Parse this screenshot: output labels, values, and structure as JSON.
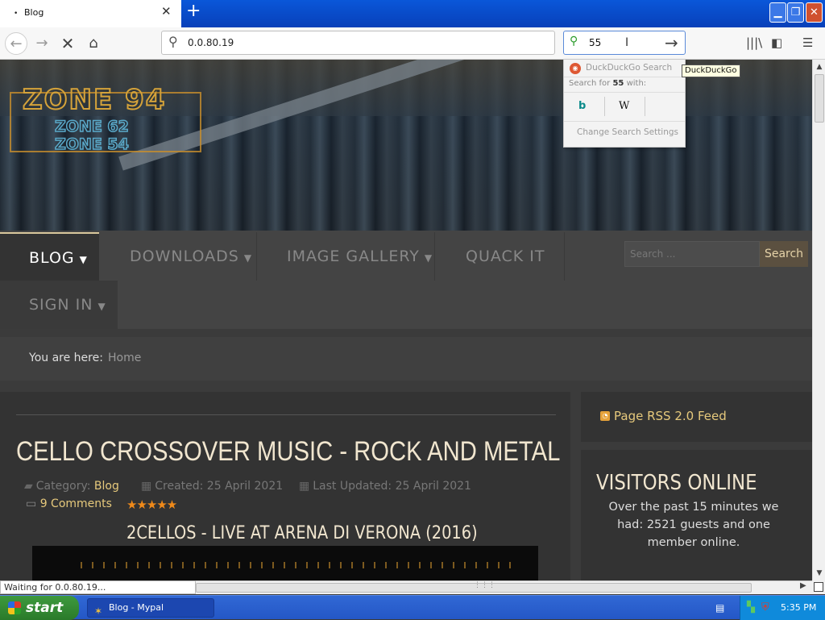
{
  "browser": {
    "tab_title": "Blog",
    "tab_icon": "•",
    "tab_close": "✕",
    "new_tab": "+",
    "url": "0.0.80.19",
    "search_value": "55",
    "window": {
      "min": "▁",
      "max": "❐",
      "close": "✕"
    }
  },
  "search_dropdown": {
    "engine": "DuckDuckGo Search",
    "search_for_prefix": "Search for ",
    "search_for_term": "55",
    "search_for_suffix": " with:",
    "engines": [
      "b",
      "W"
    ],
    "settings": "Change Search Settings",
    "tooltip": "DuckDuckGo"
  },
  "site": {
    "logo": {
      "main": "ZONE 94",
      "sub1": "ZONE 62",
      "sub2": "ZONE 54"
    },
    "menu": {
      "blog": "BLOG",
      "downloads": "DOWNLOADS",
      "gallery": "IMAGE GALLERY",
      "quack": "QUACK IT",
      "signin": "SIGN IN"
    },
    "search_placeholder": "Search ...",
    "search_button": "Search",
    "breadcrumb": {
      "label": "You are here:",
      "home": "Home"
    }
  },
  "article": {
    "title": "CELLO CROSSOVER MUSIC - ROCK AND METAL",
    "category_label": "Category: ",
    "category": "Blog",
    "created": "Created: 25 April 2021",
    "updated": "Last Updated: 25 April 2021",
    "comments": "9 Comments",
    "rating": 5,
    "stars": "★★★★★",
    "subtitle": "2CELLOS - LIVE AT ARENA DI VERONA (2016)"
  },
  "sidebar": {
    "rss": "Page RSS 2.0 Feed",
    "visitors_title": "VISITORS ONLINE",
    "visitors_text": "Over the past 15 minutes we had: 2521 guests and one member online."
  },
  "status": "Waiting for 0.0.80.19...",
  "taskbar": {
    "start": "start",
    "task": "Blog - Mypal",
    "clock": "5:35 PM"
  },
  "colors": {
    "accent": "#e6c97c",
    "title": "#f1e6cf",
    "stars": "#f08a1a"
  }
}
